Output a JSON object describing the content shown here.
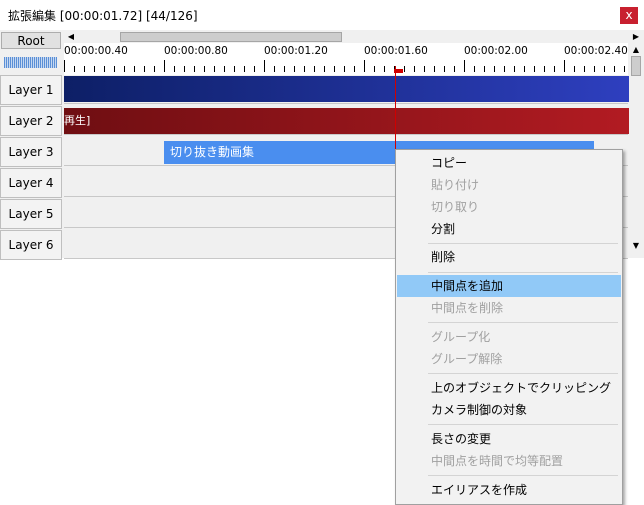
{
  "window": {
    "title": "拡張編集 [00:00:01.72] [44/126]",
    "close_label": "x"
  },
  "toolbar": {
    "root_label": "Root"
  },
  "scrollbar": {
    "left_arrow": "◀",
    "right_arrow": "▶",
    "up_arrow": "▲",
    "down_arrow": "▼"
  },
  "ruler": {
    "ticks": [
      "00:00:00.40",
      "00:00:00.80",
      "00:00:01.20",
      "00:00:01.60",
      "00:00:02.00",
      "00:00:02.40"
    ]
  },
  "layers": [
    {
      "label": "Layer 1"
    },
    {
      "label": "Layer 2"
    },
    {
      "label": "Layer 3"
    },
    {
      "label": "Layer 4"
    },
    {
      "label": "Layer 5"
    },
    {
      "label": "Layer 6"
    }
  ],
  "objects": {
    "layer2_label": "再生]",
    "layer3_label": "切り抜き動画集"
  },
  "context_menu": {
    "items": [
      {
        "label": "コピー",
        "enabled": true
      },
      {
        "label": "貼り付け",
        "enabled": false
      },
      {
        "label": "切り取り",
        "enabled": false
      },
      {
        "label": "分割",
        "enabled": true
      },
      {
        "label": "削除",
        "enabled": true
      },
      {
        "label": "中間点を追加",
        "enabled": true,
        "highlighted": true
      },
      {
        "label": "中間点を削除",
        "enabled": false
      },
      {
        "label": "グループ化",
        "enabled": false
      },
      {
        "label": "グループ解除",
        "enabled": false
      },
      {
        "label": "上のオブジェクトでクリッピング",
        "enabled": true
      },
      {
        "label": "カメラ制御の対象",
        "enabled": true
      },
      {
        "label": "長さの変更",
        "enabled": true
      },
      {
        "label": "中間点を時間で均等配置",
        "enabled": false
      },
      {
        "label": "エイリアスを作成",
        "enabled": true
      }
    ]
  },
  "colors": {
    "layer1_object": "#1a2a8a",
    "layer2_object": "#9a141b",
    "layer3_object": "#4a8eef",
    "cursor": "#d00000",
    "menu_highlight": "#91c9f7"
  }
}
